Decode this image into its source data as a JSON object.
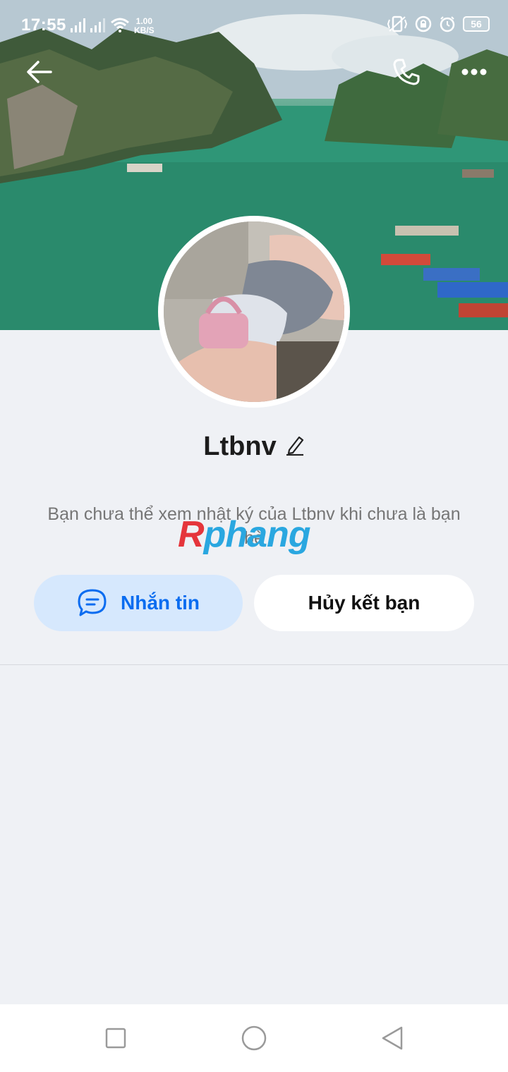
{
  "status_bar": {
    "time": "17:55",
    "speed_value": "1.00",
    "speed_unit": "KB/S",
    "battery": "56"
  },
  "profile": {
    "name": "Ltbnv",
    "notice": "Bạn chưa thể xem nhật ký của Ltbnv khi chưa là bạn bè"
  },
  "actions": {
    "message_label": "Nhắn tin",
    "unfriend_label": "Hủy kết bạn"
  },
  "watermark": {
    "first": "R",
    "rest": "phang"
  },
  "colors": {
    "accent": "#0a6cf0",
    "message_button_bg": "#d6e8fd",
    "page_bg": "#eff1f5"
  }
}
